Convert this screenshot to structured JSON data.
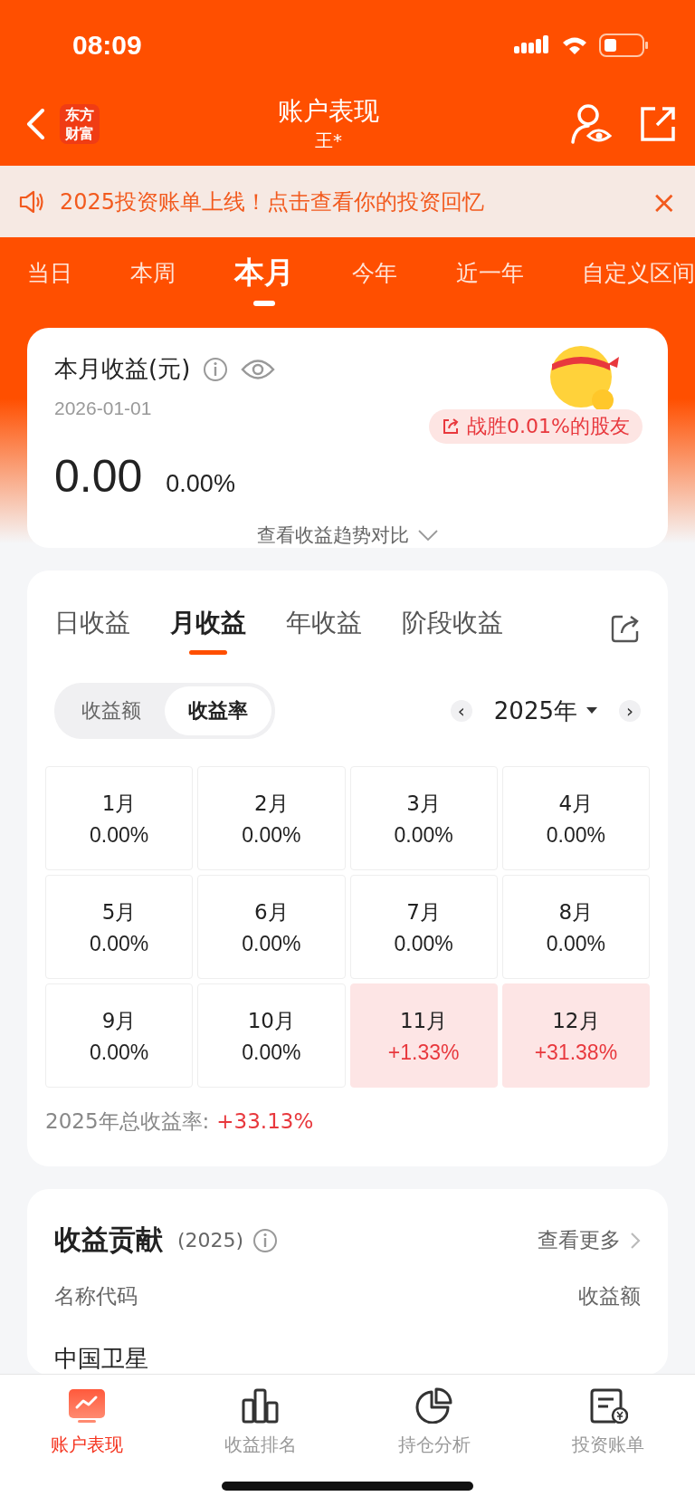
{
  "status_bar": {
    "time": "08:09"
  },
  "header": {
    "logo": "东方财富",
    "title": "账户表现",
    "subtitle": "王*"
  },
  "banner": {
    "text": "2025投资账单上线！点击查看你的投资回忆",
    "close": "×"
  },
  "period_tabs": [
    {
      "label": "当日",
      "selected": false
    },
    {
      "label": "本周",
      "selected": false
    },
    {
      "label": "本月",
      "selected": true
    },
    {
      "label": "今年",
      "selected": false
    },
    {
      "label": "近一年",
      "selected": false
    },
    {
      "label": "自定义区间",
      "selected": false
    }
  ],
  "summary": {
    "title": "本月收益(元)",
    "date": "2026-01-01",
    "badge": "战胜0.01%的股友",
    "amount": "0.00",
    "rate": "0.00%",
    "trend_link": "查看收益趋势对比"
  },
  "profit_tabs": [
    {
      "label": "日收益",
      "selected": false
    },
    {
      "label": "月收益",
      "selected": true
    },
    {
      "label": "年收益",
      "selected": false
    },
    {
      "label": "阶段收益",
      "selected": false
    }
  ],
  "mode_toggle": [
    {
      "label": "收益额",
      "selected": false
    },
    {
      "label": "收益率",
      "selected": true
    }
  ],
  "year_picker": {
    "prev": "‹",
    "value": "2025年",
    "next": "›"
  },
  "months": [
    {
      "month": "1月",
      "value": "0.00%",
      "positive": false
    },
    {
      "month": "2月",
      "value": "0.00%",
      "positive": false
    },
    {
      "month": "3月",
      "value": "0.00%",
      "positive": false
    },
    {
      "month": "4月",
      "value": "0.00%",
      "positive": false
    },
    {
      "month": "5月",
      "value": "0.00%",
      "positive": false
    },
    {
      "month": "6月",
      "value": "0.00%",
      "positive": false
    },
    {
      "month": "7月",
      "value": "0.00%",
      "positive": false
    },
    {
      "month": "8月",
      "value": "0.00%",
      "positive": false
    },
    {
      "month": "9月",
      "value": "0.00%",
      "positive": false
    },
    {
      "month": "10月",
      "value": "0.00%",
      "positive": false
    },
    {
      "month": "11月",
      "value": "+1.33%",
      "positive": true
    },
    {
      "month": "12月",
      "value": "+31.38%",
      "positive": true
    }
  ],
  "total": {
    "label": "2025年总收益率:",
    "value": "+33.13%"
  },
  "contribution": {
    "title": "收益贡献",
    "year": "(2025)",
    "more": "查看更多",
    "columns": [
      "名称代码",
      "收益额"
    ],
    "rows": [
      "中国卫星"
    ]
  },
  "bottom_nav": [
    {
      "label": "账户表现",
      "selected": true
    },
    {
      "label": "收益排名",
      "selected": false
    },
    {
      "label": "持仓分析",
      "selected": false
    },
    {
      "label": "投资账单",
      "selected": false
    }
  ]
}
